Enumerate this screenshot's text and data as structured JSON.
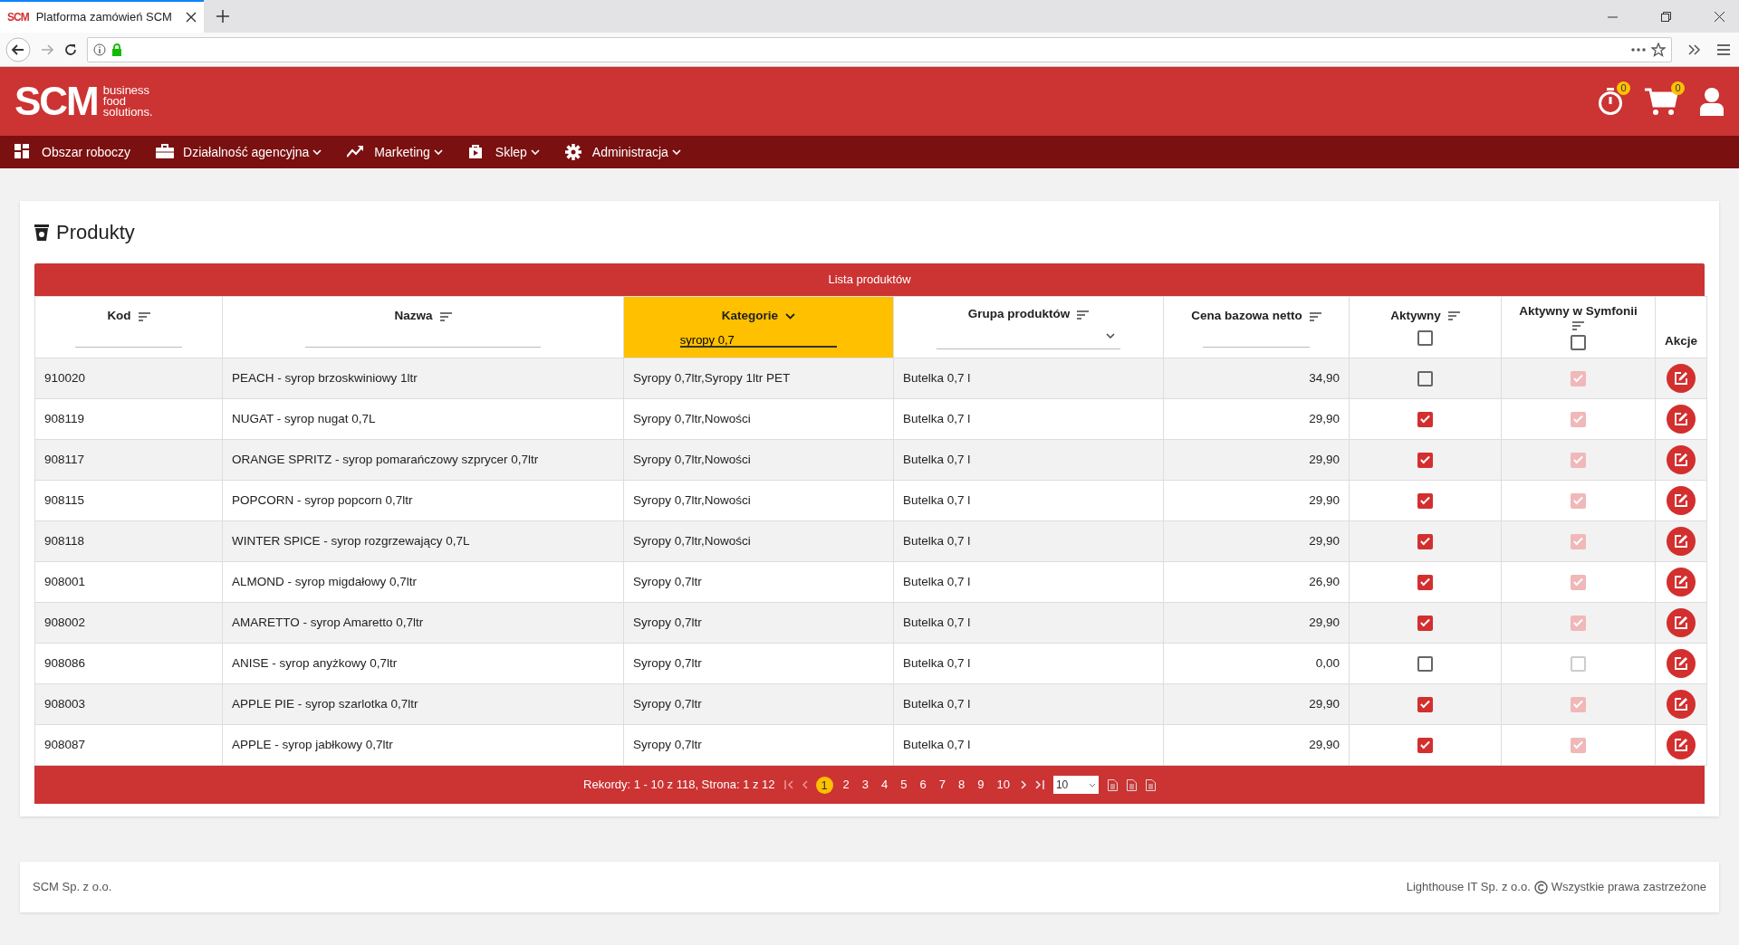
{
  "browser": {
    "favicon": "SCM",
    "tab_title": "Platforma zamówień SCM"
  },
  "header": {
    "logo": "SCM",
    "tagline": [
      "business",
      "food",
      "solutions."
    ],
    "timer_badge": "0",
    "cart_badge": "0"
  },
  "nav": [
    {
      "label": "Obszar roboczy",
      "has_menu": false
    },
    {
      "label": "Działalność agencyjna",
      "has_menu": true
    },
    {
      "label": "Marketing",
      "has_menu": true
    },
    {
      "label": "Sklep",
      "has_menu": true
    },
    {
      "label": "Administracja",
      "has_menu": true
    }
  ],
  "page_title": "Produkty",
  "table": {
    "caption": "Lista produktów",
    "columns": [
      {
        "label": "Kod",
        "kind": "text",
        "active": false
      },
      {
        "label": "Nazwa",
        "kind": "text",
        "active": false
      },
      {
        "label": "Kategorie",
        "kind": "text",
        "active": true,
        "filter_value": "syropy 0,7"
      },
      {
        "label": "Grupa produktów",
        "kind": "select",
        "active": false
      },
      {
        "label": "Cena bazowa netto",
        "kind": "text",
        "active": false
      },
      {
        "label": "Aktywny",
        "kind": "checkbox",
        "active": false,
        "filter_checked": false
      },
      {
        "label": "Aktywny w Symfonii",
        "kind": "checkbox",
        "active": false,
        "filter_checked": false
      },
      {
        "label": "Akcje",
        "kind": "none",
        "active": false
      }
    ],
    "rows": [
      {
        "code": "910020",
        "name": "PEACH - syrop brzoskwiniowy 1ltr",
        "category": "Syropy 0,7ltr,Syropy 1ltr PET",
        "group": "Butelka 0,7 l",
        "price": "34,90",
        "active": false,
        "symphony": true
      },
      {
        "code": "908119",
        "name": "NUGAT - syrop nugat 0,7L",
        "category": "Syropy 0,7ltr,Nowości",
        "group": "Butelka 0,7 l",
        "price": "29,90",
        "active": true,
        "symphony": true
      },
      {
        "code": "908117",
        "name": "ORANGE SPRITZ - syrop pomarańczowy szprycer 0,7ltr",
        "category": "Syropy 0,7ltr,Nowości",
        "group": "Butelka 0,7 l",
        "price": "29,90",
        "active": true,
        "symphony": true
      },
      {
        "code": "908115",
        "name": "POPCORN - syrop popcorn 0,7ltr",
        "category": "Syropy 0,7ltr,Nowości",
        "group": "Butelka 0,7 l",
        "price": "29,90",
        "active": true,
        "symphony": true
      },
      {
        "code": "908118",
        "name": "WINTER SPICE - syrop rozgrzewający 0,7L",
        "category": "Syropy 0,7ltr,Nowości",
        "group": "Butelka 0,7 l",
        "price": "29,90",
        "active": true,
        "symphony": true
      },
      {
        "code": "908001",
        "name": "ALMOND - syrop migdałowy 0,7ltr",
        "category": "Syropy 0,7ltr",
        "group": "Butelka 0,7 l",
        "price": "26,90",
        "active": true,
        "symphony": true
      },
      {
        "code": "908002",
        "name": "AMARETTO - syrop Amaretto 0,7ltr",
        "category": "Syropy 0,7ltr",
        "group": "Butelka 0,7 l",
        "price": "29,90",
        "active": true,
        "symphony": true
      },
      {
        "code": "908086",
        "name": "ANISE - syrop anyżkowy 0,7ltr",
        "category": "Syropy 0,7ltr",
        "group": "Butelka 0,7 l",
        "price": "0,00",
        "active": false,
        "symphony": false
      },
      {
        "code": "908003",
        "name": "APPLE PIE - syrop szarlotka 0,7ltr",
        "category": "Syropy 0,7ltr",
        "group": "Butelka 0,7 l",
        "price": "29,90",
        "active": true,
        "symphony": true
      },
      {
        "code": "908087",
        "name": "APPLE - syrop jabłkowy 0,7ltr",
        "category": "Syropy 0,7ltr",
        "group": "Butelka 0,7 l",
        "price": "29,90",
        "active": true,
        "symphony": true
      }
    ]
  },
  "pagination": {
    "summary": "Rekordy: 1 - 10 z 118, Strona: 1 z 12",
    "pages": [
      {
        "label": "1",
        "selected": true
      },
      {
        "label": "2",
        "selected": false
      },
      {
        "label": "3",
        "selected": false
      },
      {
        "label": "4",
        "selected": false
      },
      {
        "label": "5",
        "selected": false
      },
      {
        "label": "6",
        "selected": false
      },
      {
        "label": "7",
        "selected": false
      },
      {
        "label": "8",
        "selected": false
      },
      {
        "label": "9",
        "selected": false
      },
      {
        "label": "10",
        "selected": false
      }
    ],
    "page_size": "10"
  },
  "footer": {
    "left": "SCM Sp. z o.o.",
    "right_company": "Lighthouse IT Sp. z o.o.",
    "right_rights": "Wszystkie prawa zastrzeżone"
  }
}
